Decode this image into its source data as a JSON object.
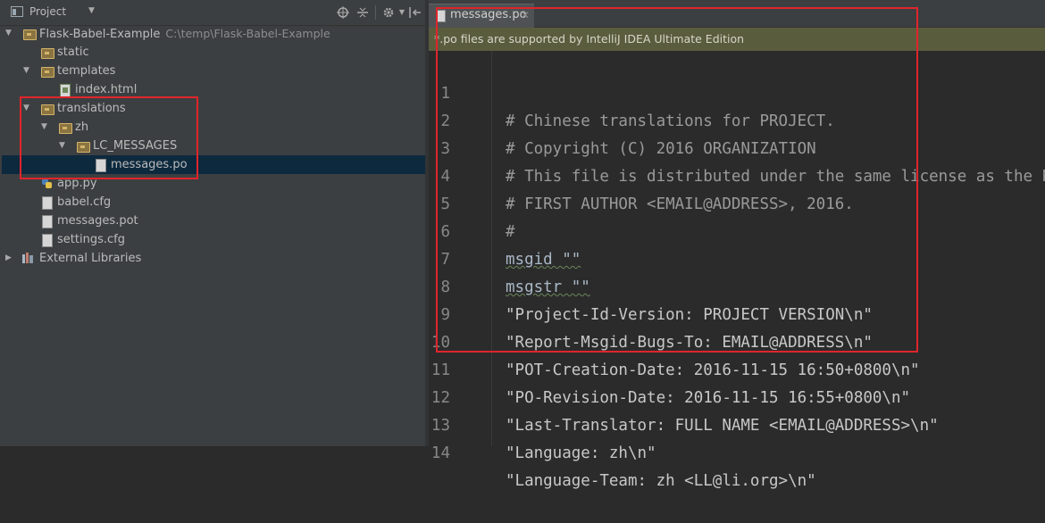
{
  "project_panel": {
    "title": "Project",
    "toolbar": {
      "target_icon": "crosshair-icon",
      "collapse_icon": "collapse-all-icon",
      "settings_icon": "gear-icon",
      "hide_icon": "hide-panel-icon"
    },
    "tree": {
      "root": {
        "label": "Flask-Babel-Example",
        "path": "C:\\temp\\Flask-Babel-Example"
      },
      "static": "static",
      "templates": "templates",
      "index_html": "index.html",
      "translations": "translations",
      "zh": "zh",
      "lc_messages": "LC_MESSAGES",
      "messages_po": "messages.po",
      "app_py": "app.py",
      "babel_cfg": "babel.cfg",
      "messages_pot": "messages.pot",
      "settings_cfg": "settings.cfg",
      "external_libraries": "External Libraries"
    }
  },
  "editor": {
    "tab": {
      "label": "messages.po",
      "close": "✕"
    },
    "notice": "*.po files are supported by IntelliJ IDEA Ultimate Edition",
    "lines": [
      {
        "num": "1",
        "text": "# Chinese translations for PROJECT."
      },
      {
        "num": "2",
        "text": "# Copyright (C) 2016 ORGANIZATION"
      },
      {
        "num": "3",
        "text": "# This file is distributed under the same license as the PROJ"
      },
      {
        "num": "4",
        "text": "# FIRST AUTHOR <EMAIL@ADDRESS>, 2016."
      },
      {
        "num": "5",
        "text": "#"
      },
      {
        "num": "6",
        "text": "msgid \"\""
      },
      {
        "num": "7",
        "text": "msgstr \"\""
      },
      {
        "num": "8",
        "text": "\"Project-Id-Version: PROJECT VERSION\\n\""
      },
      {
        "num": "9",
        "text": "\"Report-Msgid-Bugs-To: EMAIL@ADDRESS\\n\""
      },
      {
        "num": "10",
        "text": "\"POT-Creation-Date: 2016-11-15 16:50+0800\\n\""
      },
      {
        "num": "11",
        "text": "\"PO-Revision-Date: 2016-11-15 16:55+0800\\n\""
      },
      {
        "num": "12",
        "text": "\"Last-Translator: FULL NAME <EMAIL@ADDRESS>\\n\""
      },
      {
        "num": "13",
        "text": "\"Language: zh\\n\""
      },
      {
        "num": "14",
        "text": "\"Language-Team: zh <LL@li.org>\\n\""
      }
    ]
  },
  "colors": {
    "highlight_box": "#e0252b",
    "notice_bg": "#5a5c3e",
    "selection_bg": "#0d293e"
  }
}
